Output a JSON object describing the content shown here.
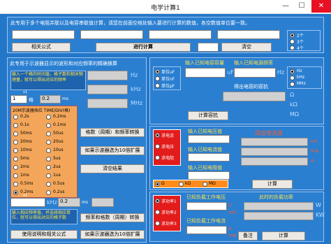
{
  "window": {
    "title": "电学计算1",
    "min": "—",
    "max": "☐",
    "close": "✕"
  },
  "top": {
    "desc": "此专用于多个电阻并联以及电容串联值计算，请您在前面空格处输入要进行计算的数值，各空数值单位要一致。",
    "btn_about": "相关公式",
    "btn_calc": "进行计算",
    "btn_clear": "清空",
    "radios": [
      "2个",
      "3个",
      "4个"
    ]
  },
  "osc": {
    "title": "此专用于示波器显示的波形和对应频率的精确换算",
    "note1": "输入一个格的时间值，格子数和相关物理量，就可以得出对应的频率",
    "units_right": [
      "Hz",
      "kHz",
      "MHz"
    ],
    "grid_label": "格",
    "val1": "1",
    "val2": "0.2",
    "unit_ms": "ms",
    "tag_small": [
      "x1",
      "x1"
    ],
    "timebase_title": "20M示波器挡位 TIME/DIV(格)",
    "timebase_left": [
      "0.2s",
      "0.1s",
      "50ms",
      "20ms",
      "10ms",
      "5ms",
      "2ms",
      "1ms",
      "0.5ms",
      "0.2ms"
    ],
    "timebase_right": [
      "0.2ms",
      "0.1ms",
      "50us",
      "20us",
      "10us",
      "5us",
      "2us",
      "1us",
      "0.5us",
      "0.2us"
    ],
    "btn_convert1": "格数（周期）和频率转换",
    "btn_expand1": "如果示波器选为10倍扩展",
    "btn_clear": "清空结果",
    "unit_khz": "kHz",
    "val3": "0.2",
    "val3_unit": "ms",
    "note2": "输入相应频率值，并选择相应单位，就可以得出对应的格子数",
    "btn_convert2": "频率和格数（周期）转换",
    "btn_expand2": "如果示波器选为10倍扩展",
    "btn_help": "使用说明和相关公式"
  },
  "cap": {
    "input_label": "输入已知电容容量",
    "freq_label": "输入已知电源频率",
    "units": [
      "单位uF",
      "单位nF",
      "单位pF"
    ],
    "unit_uF": "uF",
    "unit_Hz": "Hz",
    "freq_units": [
      "Hz",
      "kHz",
      "MHz"
    ],
    "result_label": "得出电容的容抗",
    "btn_calc": "计算容抗",
    "ohm_units": [
      "Ω",
      "kΩ",
      "MΩ"
    ]
  },
  "ohm": {
    "choices": [
      "求电流",
      "求电压",
      "求电阻"
    ],
    "known_v": "输入已知电压值",
    "known_i": "输入已知电流值",
    "known_r": "输入已知电阻值",
    "result": "得出电流值",
    "units_i": [
      "uA",
      "mA",
      "A"
    ],
    "units_v": [
      "mV",
      "V",
      "kV"
    ],
    "units_r": [
      "Ω",
      "kΩ",
      "MΩ"
    ],
    "radio_units": [
      "Ω",
      "kΩ",
      "MΩ"
    ],
    "btn_calc": "计算"
  },
  "power": {
    "choices": [
      "求功率1",
      "求功率2",
      "求功率3"
    ],
    "label1": "已知负载工作电压",
    "label2": "已知负载工作电流",
    "result": "此时的负载功率",
    "units_v": [
      "V",
      "mV"
    ],
    "units_i": [
      "A",
      "mA"
    ],
    "units_p": [
      "W",
      "KW"
    ],
    "btn_note": "备注",
    "btn_calc": "计算"
  }
}
